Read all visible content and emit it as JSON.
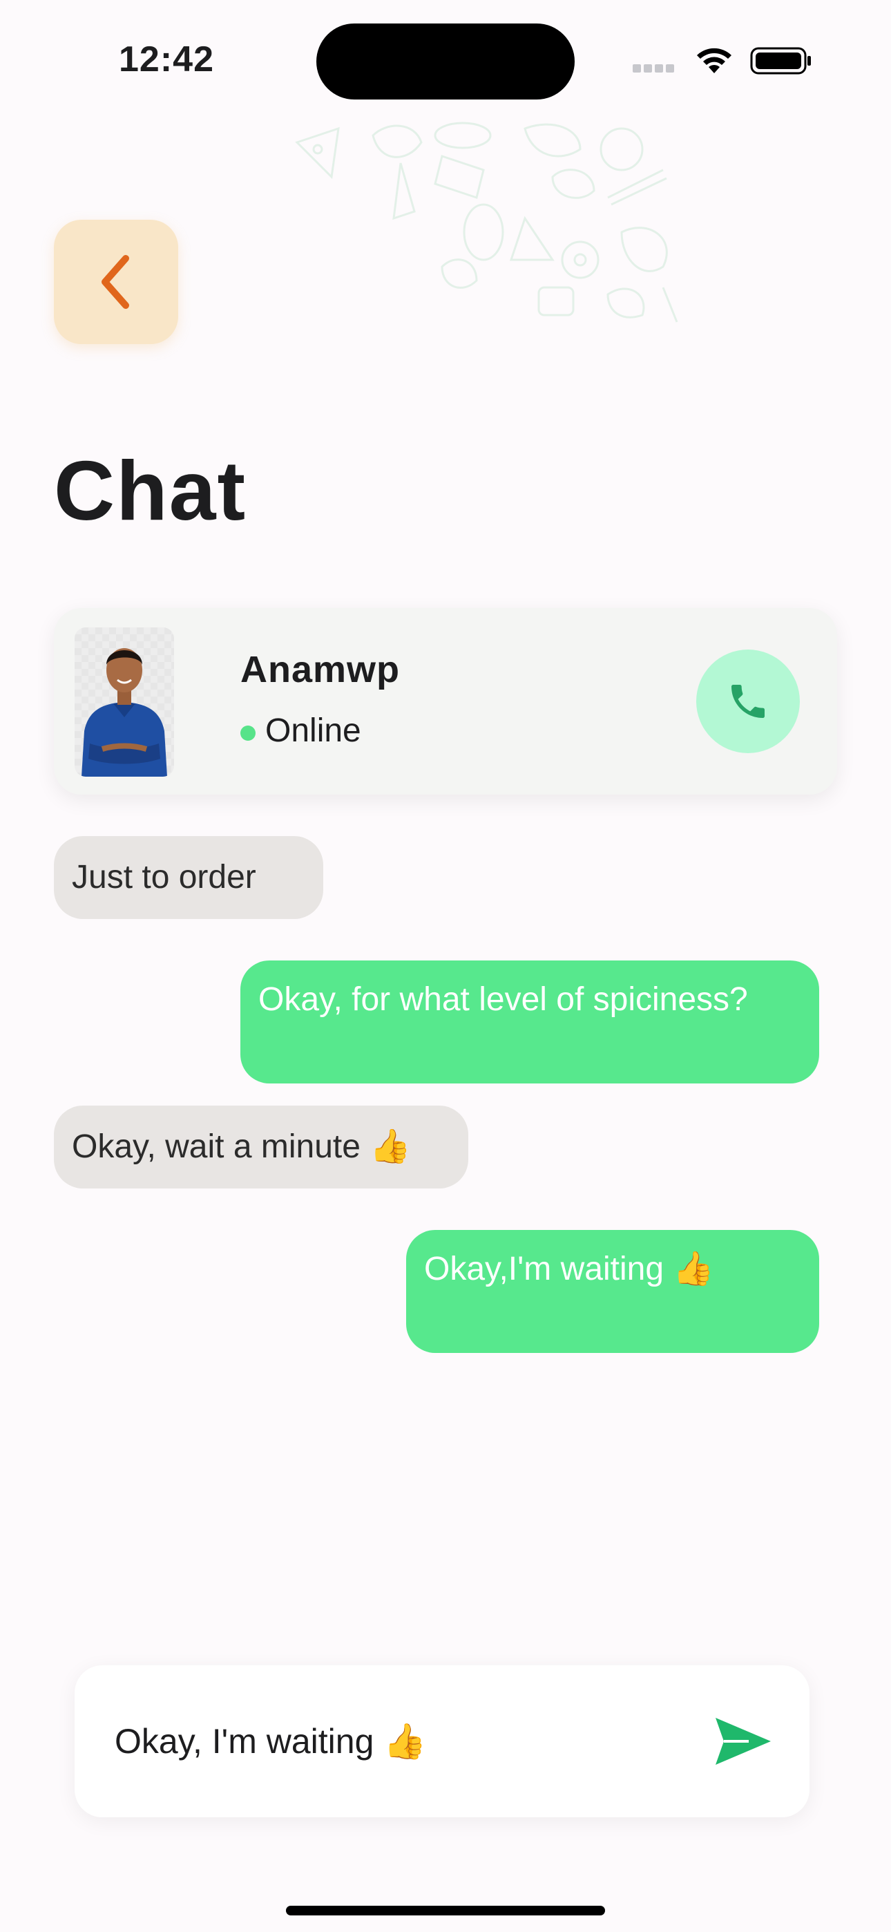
{
  "status_bar": {
    "time": "12:42"
  },
  "header": {
    "title": "Chat"
  },
  "contact": {
    "name": "Anamwp",
    "status": "Online"
  },
  "messages": [
    {
      "direction": "incoming",
      "text": "Just to order"
    },
    {
      "direction": "outgoing",
      "text": "Okay, for what level of spiciness?"
    },
    {
      "direction": "incoming",
      "text": "Okay, wait a minute 👍"
    },
    {
      "direction": "outgoing",
      "text": "Okay,I'm waiting 👍"
    }
  ],
  "composer": {
    "value": "Okay, I'm waiting 👍"
  },
  "icons": {
    "back": "chevron-left-icon",
    "call": "phone-icon",
    "send": "send-icon",
    "wifi": "wifi-icon",
    "battery": "battery-icon",
    "signal": "signal-icon"
  },
  "colors": {
    "accent_green": "#57E88D",
    "call_bg": "#B3F8D4",
    "back_bg": "#F9E6C8",
    "back_icon": "#E0661C",
    "incoming_bg": "#E8E5E3",
    "online": "#57E389",
    "send_icon": "#1FB86B"
  }
}
